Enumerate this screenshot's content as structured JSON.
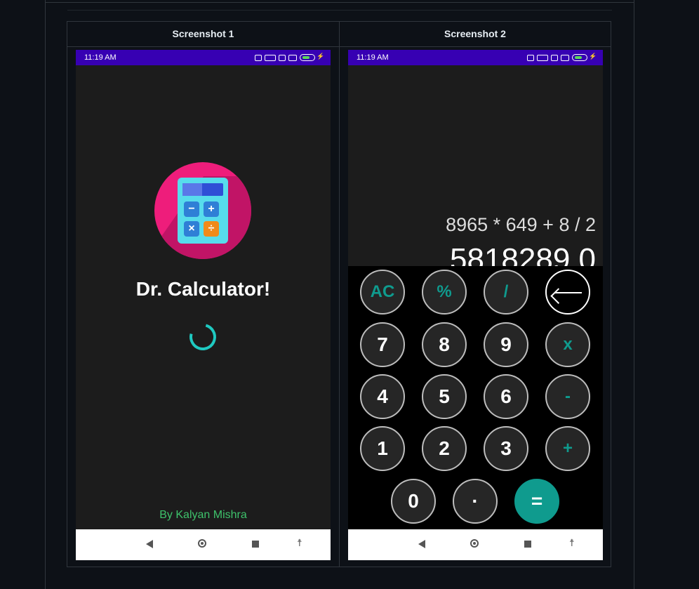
{
  "table": {
    "headers": [
      "Screenshot 1",
      "Screenshot 2"
    ]
  },
  "status_bar": {
    "time": "11:19 AM"
  },
  "splash": {
    "app_name": "Dr. Calculator!",
    "byline": "By Kalyan Mishra",
    "logo_keys": [
      "−",
      "+",
      "×",
      "÷"
    ]
  },
  "calculator": {
    "expression": "8965 * 649 + 8 / 2",
    "result": "5818289.0",
    "keys": {
      "ac": "AC",
      "percent": "%",
      "divide": "/",
      "backspace": "",
      "k7": "7",
      "k8": "8",
      "k9": "9",
      "multiply": "x",
      "k4": "4",
      "k5": "5",
      "k6": "6",
      "minus": "-",
      "k1": "1",
      "k2": "2",
      "k3": "3",
      "plus": "+",
      "k0": "0",
      "dot": "·",
      "equals": "="
    }
  },
  "colors": {
    "status_bar": "#3700b3",
    "accent_teal": "#0f9b8e",
    "logo_pink": "#ee1d7b",
    "byline_green": "#3ec26b"
  },
  "icons": [
    "battery-icon",
    "signal-icon",
    "nav-back-icon",
    "nav-home-icon",
    "nav-recents-icon",
    "accessibility-icon",
    "backspace-icon",
    "loading-spinner"
  ]
}
